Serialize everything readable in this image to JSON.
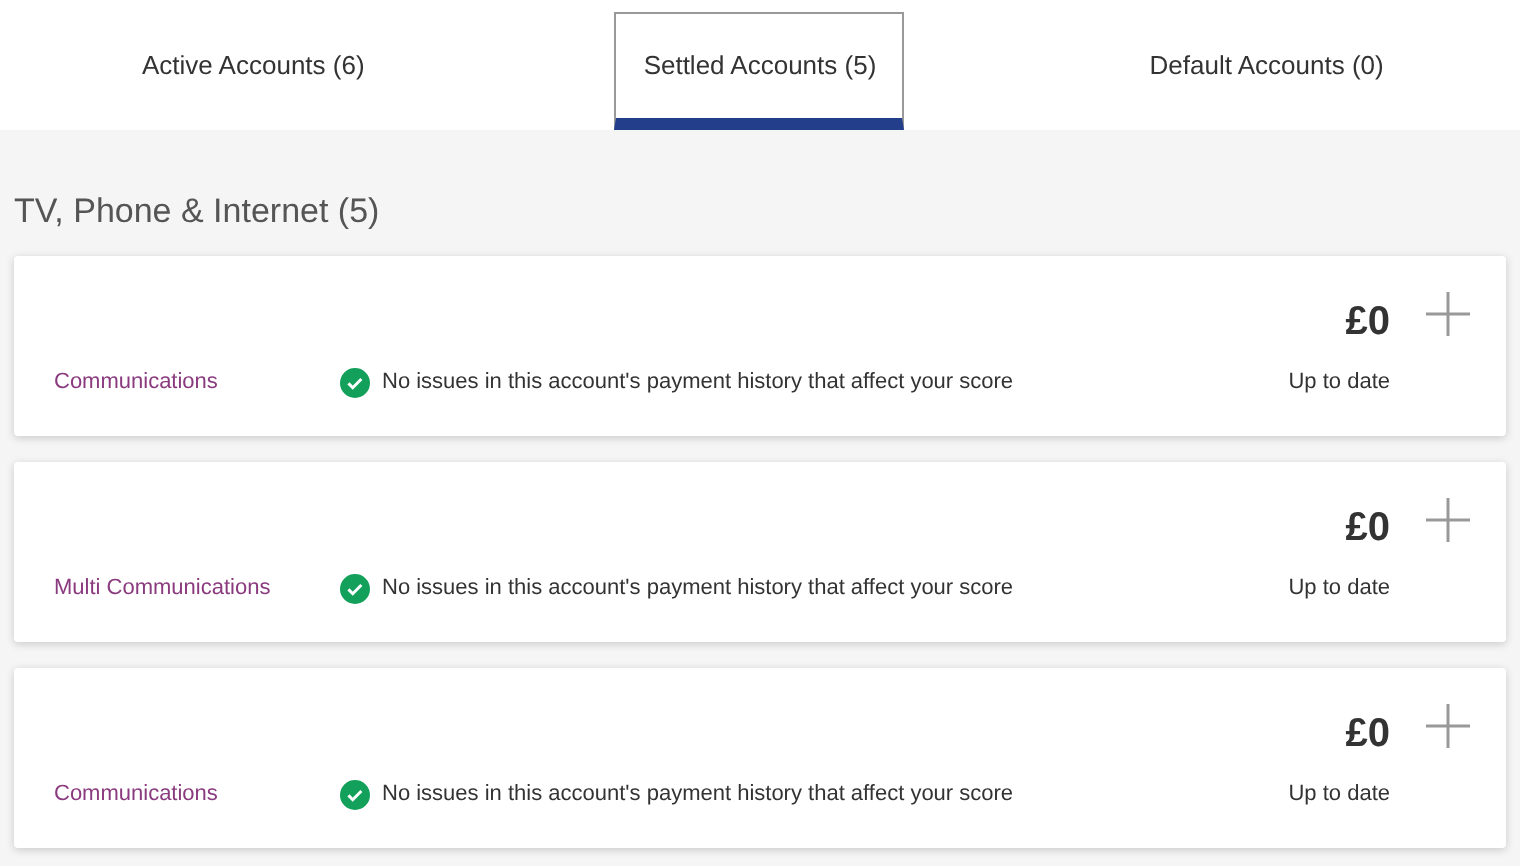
{
  "tabs": [
    {
      "label": "Active Accounts (6)",
      "selected": false
    },
    {
      "label": "Settled Accounts (5)",
      "selected": true
    },
    {
      "label": "Default Accounts (0)",
      "selected": false
    }
  ],
  "section": {
    "title": "TV, Phone & Internet (5)"
  },
  "accounts": [
    {
      "name": "Communications",
      "status": "No issues in this account's payment history that affect your score",
      "amount": "£0",
      "state": "Up to date"
    },
    {
      "name": "Multi Communications",
      "status": "No issues in this account's payment history that affect your score",
      "amount": "£0",
      "state": "Up to date"
    },
    {
      "name": "Communications",
      "status": "No issues in this account's payment history that affect your score",
      "amount": "£0",
      "state": "Up to date"
    }
  ]
}
